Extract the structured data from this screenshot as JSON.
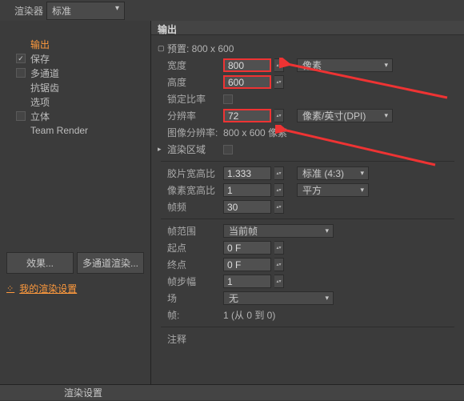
{
  "top": {
    "renderer_label": "渲染器",
    "renderer_value": "标准",
    "output_label": "输出"
  },
  "sidebar": {
    "items": [
      {
        "label": "输出",
        "selected": true
      },
      {
        "label": "保存",
        "checked": true
      },
      {
        "label": "多通道"
      },
      {
        "label": "抗锯齿"
      },
      {
        "label": "选项"
      },
      {
        "label": "立体"
      },
      {
        "label": "Team Render"
      }
    ],
    "effects_btn": "效果...",
    "multipass_btn": "多通道渲染...",
    "my_settings": "我的渲染设置"
  },
  "out": {
    "preset_label": "预置: 800 x 600",
    "width_label": "宽度",
    "width": "800",
    "height_label": "高度",
    "height": "600",
    "lock_label": "锁定比率",
    "res_label": "分辨率",
    "res": "72",
    "unit_px": "像素",
    "unit_dpi": "像素/英寸(DPI)",
    "img_res_label": "图像分辨率:",
    "img_res_value": "800 x 600 像素",
    "render_region": "渲染区域",
    "film_aspect_label": "胶片宽高比",
    "film_aspect": "1.333",
    "film_mode": "标准 (4:3)",
    "pixel_aspect_label": "像素宽高比",
    "pixel_aspect": "1",
    "pixel_mode": "平方",
    "fps_label": "帧频",
    "fps": "30",
    "range_label": "帧范围",
    "range_value": "当前帧",
    "start_label": "起点",
    "start": "0 F",
    "end_label": "终点",
    "end": "0 F",
    "step_label": "帧步幅",
    "step": "1",
    "field_label": "场",
    "field_value": "无",
    "frames_label": "帧:",
    "frames_value": "1 (从 0 到 0)",
    "notes_label": "注释"
  },
  "footer": {
    "title": "渲染设置"
  }
}
